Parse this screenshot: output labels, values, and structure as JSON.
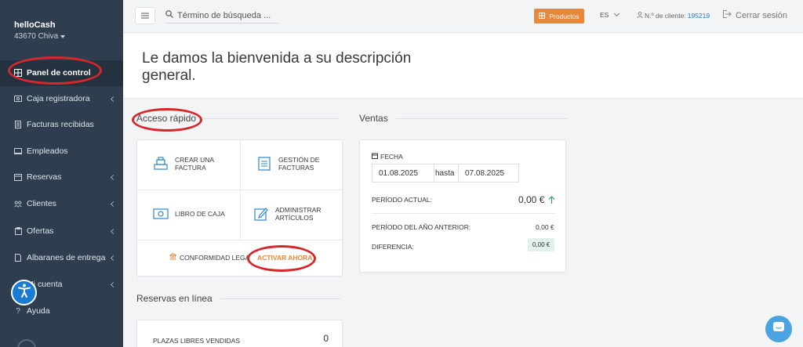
{
  "sidebar": {
    "brand_name": "helloCash",
    "location": "43670 Chiva",
    "items": [
      {
        "label": "Panel de control",
        "icon": "dashboard-icon"
      },
      {
        "label": "Caja registradora",
        "icon": "cash-register-icon"
      },
      {
        "label": "Facturas recibidas",
        "icon": "invoice-icon"
      },
      {
        "label": "Empleados",
        "icon": "employees-icon"
      },
      {
        "label": "Reservas",
        "icon": "calendar-icon"
      },
      {
        "label": "Clientes",
        "icon": "customers-icon"
      },
      {
        "label": "Ofertas",
        "icon": "offers-icon"
      },
      {
        "label": "Albaranes de entrega",
        "icon": "delivery-note-icon"
      },
      {
        "label": "Mi cuenta",
        "icon": "account-icon"
      },
      {
        "label": "Ayuda",
        "icon": "help-icon"
      }
    ]
  },
  "topbar": {
    "search_placeholder": "Término de búsqueda ...",
    "products_label": "Productos",
    "language": "ES",
    "client_label": "N.º de cliente:",
    "client_number": "195219",
    "logout_label": "Cerrar sesión"
  },
  "welcome": {
    "title": "Le damos la bienvenida a su descripción general."
  },
  "quick_access": {
    "title": "Acceso rápido",
    "create_invoice": "CREAR UNA FACTURA",
    "manage_invoices": "GESTIÓN DE FACTURAS",
    "cash_book": "LIBRO DE CAJA",
    "manage_items": "ADMINISTRAR ARTÍCULOS",
    "compliance": "CONFORMIDAD LEGA",
    "activate": "ACTIVAR AHORA"
  },
  "sales": {
    "title": "Ventas",
    "date_label": "FECHA",
    "date_from": "01.08.2025",
    "until": "hasta",
    "date_to": "07.08.2025",
    "current_period_label": "PERÍODO ACTUAL:",
    "current_period_value": "0,00 €",
    "prev_year_label": "PERÍODO DEL AÑO ANTERIOR:",
    "prev_year_value": "0,00 €",
    "difference_label": "DIFERENCIA:",
    "difference_value": "0,00 €"
  },
  "online_reservations": {
    "title": "Reservas en línea",
    "sold_slots_label": "PLAZAS LIBRES VENDIDAS",
    "sold_slots_value": "0"
  },
  "colors": {
    "sidebar_bg": "#2f3e4e",
    "accent_orange": "#e8883a",
    "annotation_red": "#d9262b",
    "link_blue": "#1f7acb"
  }
}
